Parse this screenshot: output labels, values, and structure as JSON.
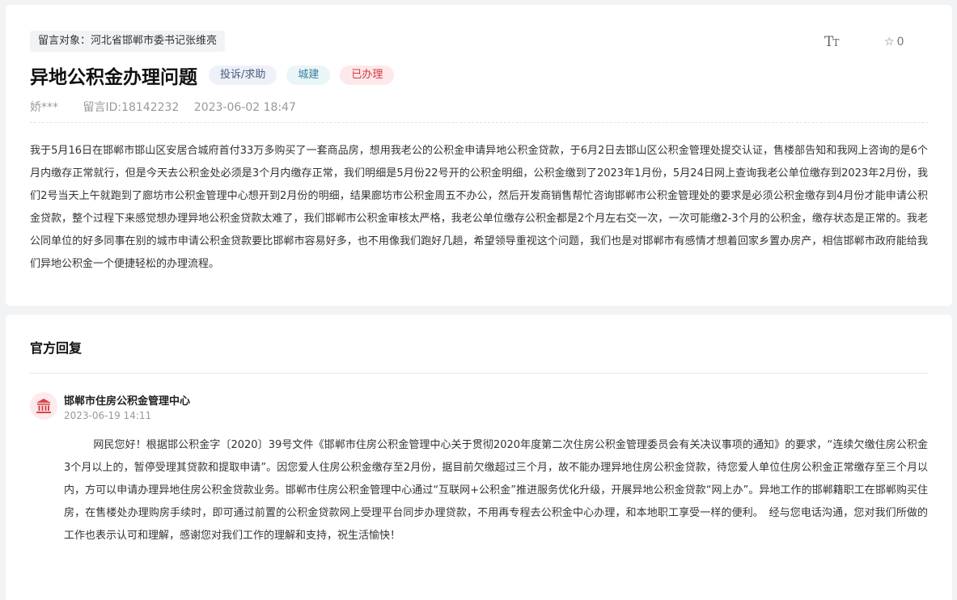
{
  "message": {
    "target": "留言对象：河北省邯郸市委书记张维亮",
    "title": "异地公积金办理问题",
    "tags": {
      "type": "投诉/求助",
      "category": "城建",
      "status": "已办理"
    },
    "author": "娇***",
    "message_id": "留言ID:18142232",
    "datetime": "2023-06-02 18:47",
    "font_icon_label": "TT",
    "favorite_count": "0",
    "content": "我于5月16日在邯郸市邯山区安居合城府首付33万多购买了一套商品房，想用我老公的公积金申请异地公积金贷款，于6月2日去邯山区公积金管理处提交认证，售楼部告知和我网上咨询的是6个月内缴存正常就行，但是今天去公积金处必须是3个月内缴存正常，我们明细是5月份22号开的公积金明细，公积金缴到了2023年1月份，5月24日网上查询我老公单位缴存到2023年2月份，我们2号当天上午就跑到了廊坊市公积金管理中心想开到2月份的明细，结果廊坊市公积金周五不办公，然后开发商销售帮忙咨询邯郸市公积金管理处的要求是必须公积金缴存到4月份才能申请公积金贷款，整个过程下来感觉想办理异地公积金贷款太难了，我们邯郸市公积金审核太严格，我老公单位缴存公积金都是2个月左右交一次，一次可能缴2-3个月的公积金，缴存状态是正常的。我老公同单位的好多同事在别的城市申请公积金贷款要比邯郸市容易好多，也不用像我们跑好几趟，希望领导重视这个问题，我们也是对邯郸市有感情才想着回家乡置办房产，相信邯郸市政府能给我们异地公积金一个便捷轻松的办理流程。"
  },
  "reply": {
    "heading": "官方回复",
    "org": "邯郸市住房公积金管理中心",
    "date": "2023-06-19 14:11",
    "content": "网民您好！根据邯公积金字〔2020〕39号文件《邯郸市住房公积金管理中心关于贯彻2020年度第二次住房公积金管理委员会有关决议事项的通知》的要求，“连续欠缴住房公积金3个月以上的，暂停受理其贷款和提取申请”。因您爱人住房公积金缴存至2月份，据目前欠缴超过三个月，故不能办理异地住房公积金贷款，待您爱人单位住房公积金正常缴存至三个月以内，方可以申请办理异地住房公积金贷款业务。邯郸市住房公积金管理中心通过“互联网+公积金”推进服务优化升级，开展异地公积金贷款“网上办”。异地工作的邯郸籍职工在邯郸购买住房，在售楼处办理购房手续时，即可通过前置的公积金贷款网上受理平台同步办理贷款，不用再专程去公积金中心办理，和本地职工享受一样的便利。　经与您电话沟通，您对我们所做的工作也表示认可和理解，感谢您对我们工作的理解和支持，祝生活愉快！",
    "avatar_icon": "bank-building-icon"
  },
  "colors": {
    "status_red": "#d9363e",
    "avatar_red": "#d9434a",
    "page_bg": "#f2f3f5"
  }
}
